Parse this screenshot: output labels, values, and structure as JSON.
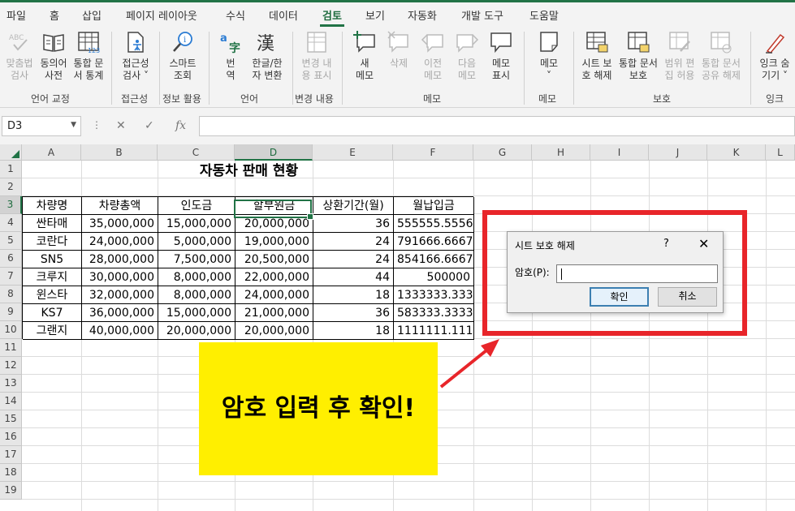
{
  "menu": {
    "tabs": [
      "파일",
      "홈",
      "삽입",
      "페이지 레이아웃",
      "수식",
      "데이터",
      "검토",
      "보기",
      "자동화",
      "개발 도구",
      "도움말"
    ],
    "active": "검토"
  },
  "ribbon": {
    "buttons": [
      {
        "line1": "맞춤법",
        "line2": "검사",
        "icon": "spellcheck-icon",
        "enabled": false
      },
      {
        "line1": "동의어",
        "line2": "사전",
        "icon": "thesaurus-book-icon",
        "enabled": true
      },
      {
        "line1": "통합 문",
        "line2": "서 통계",
        "icon": "workbook-statistics-icon",
        "enabled": true
      },
      {
        "line1": "접근성",
        "line2": "검사 ˅",
        "icon": "accessibility-check-icon",
        "enabled": true
      },
      {
        "line1": "스마트",
        "line2": "조회",
        "icon": "smart-lookup-icon",
        "enabled": true
      },
      {
        "line1": "번",
        "line2": "역",
        "icon": "translate-icon",
        "enabled": true
      },
      {
        "line1": "한글/한",
        "line2": "자 변환",
        "icon": "hangul-hanja-icon",
        "enabled": true
      },
      {
        "line1": "변경 내",
        "line2": "용 표시",
        "icon": "show-changes-icon",
        "enabled": false
      },
      {
        "line1": "새",
        "line2": "메모",
        "icon": "new-comment-icon",
        "enabled": true
      },
      {
        "line1": "삭제",
        "line2": "",
        "icon": "delete-comment-icon",
        "enabled": false
      },
      {
        "line1": "이전",
        "line2": "메모",
        "icon": "previous-comment-icon",
        "enabled": false
      },
      {
        "line1": "다음",
        "line2": "메모",
        "icon": "next-comment-icon",
        "enabled": false
      },
      {
        "line1": "메모",
        "line2": "표시",
        "icon": "show-comments-icon",
        "enabled": true
      },
      {
        "line1": "메모",
        "line2": "˅",
        "icon": "notes-icon",
        "enabled": true
      },
      {
        "line1": "시트 보",
        "line2": "호 해제",
        "icon": "unprotect-sheet-icon",
        "enabled": true
      },
      {
        "line1": "통합 문서",
        "line2": "보호",
        "icon": "protect-workbook-icon",
        "enabled": true
      },
      {
        "line1": "범위 편",
        "line2": "집 허용",
        "icon": "allow-edit-ranges-icon",
        "enabled": false
      },
      {
        "line1": "통합 문서",
        "line2": "공유 해제",
        "icon": "unshare-workbook-icon",
        "enabled": false
      },
      {
        "line1": "잉크 숨",
        "line2": "기기 ˅",
        "icon": "hide-ink-icon",
        "enabled": true
      }
    ],
    "groups": [
      "언어 교정",
      "접근성",
      "정보 활용",
      "언어",
      "변경 내용",
      "메모",
      "메모",
      "보호",
      "잉크"
    ]
  },
  "formula_bar": {
    "name_box": "D3",
    "formula": ""
  },
  "columns": [
    "A",
    "B",
    "C",
    "D",
    "E",
    "F",
    "G",
    "H",
    "I",
    "J",
    "K",
    "L"
  ],
  "selected_column": "D",
  "rows": [
    "1",
    "2",
    "3",
    "4",
    "5",
    "6",
    "7",
    "8",
    "9",
    "10",
    "11",
    "12",
    "13",
    "14",
    "15",
    "16",
    "17",
    "18",
    "19"
  ],
  "selected_row": "3",
  "sheet": {
    "title": "자동차 판매 현황",
    "headers": [
      "차량명",
      "차량총액",
      "인도금",
      "할부원금",
      "상환기간(월)",
      "월납입금"
    ],
    "data": [
      [
        "싼타매",
        "35,000,000",
        "15,000,000",
        "20,000,000",
        "36",
        "555555.5556"
      ],
      [
        "코란다",
        "24,000,000",
        "5,000,000",
        "19,000,000",
        "24",
        "791666.6667"
      ],
      [
        "SN5",
        "28,000,000",
        "7,500,000",
        "20,500,000",
        "24",
        "854166.6667"
      ],
      [
        "크루지",
        "30,000,000",
        "8,000,000",
        "22,000,000",
        "44",
        "500000"
      ],
      [
        "윈스타",
        "32,000,000",
        "8,000,000",
        "24,000,000",
        "18",
        "1333333.333"
      ],
      [
        "KS7",
        "36,000,000",
        "15,000,000",
        "21,000,000",
        "36",
        "583333.3333"
      ],
      [
        "그랜지",
        "40,000,000",
        "20,000,000",
        "20,000,000",
        "18",
        "1111111.111"
      ]
    ]
  },
  "dialog": {
    "title": "시트 보호 해제",
    "help": "?",
    "close": "✕",
    "password_label": "암호(P):",
    "password_value": "",
    "ok_label": "확인",
    "cancel_label": "취소"
  },
  "callout": {
    "text": "암호 입력 후 확인!"
  },
  "colors": {
    "excel_green": "#217346",
    "highlight_red": "#e8252a",
    "callout_yellow": "#ffef00"
  }
}
